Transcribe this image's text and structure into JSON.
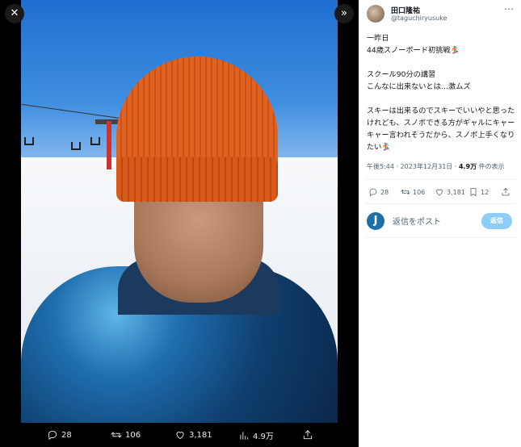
{
  "viewer": {
    "close_icon": "close-icon",
    "expand_icon": "expand-icon",
    "actions": {
      "replies": "28",
      "retweets": "106",
      "likes": "3,181",
      "views": "4.9万"
    }
  },
  "panel": {
    "author": {
      "name": "田口隆祐",
      "handle": "@taguchiryusuke"
    },
    "text": "一昨日\n44歳スノーボード初挑戦🏂\n\nスクール90分の講習\nこんなに出来ないとは…激ムズ\n\nスキーは出来るのでスキーでいいやと思ったけれども、スノボできる方がギャルにキャーキャー言われそうだから、スノボ上手くなりたい🏂",
    "meta": {
      "time": "午後5:44 · 2023年12月31日 · ",
      "views": "4.9万",
      "views_suffix": " 件の表示"
    },
    "actions": {
      "replies": "28",
      "retweets": "106",
      "likes": "3,181",
      "bookmarks": "12"
    },
    "reply": {
      "avatar_letter": "J",
      "placeholder": "返信をポスト",
      "button": "返信"
    }
  }
}
